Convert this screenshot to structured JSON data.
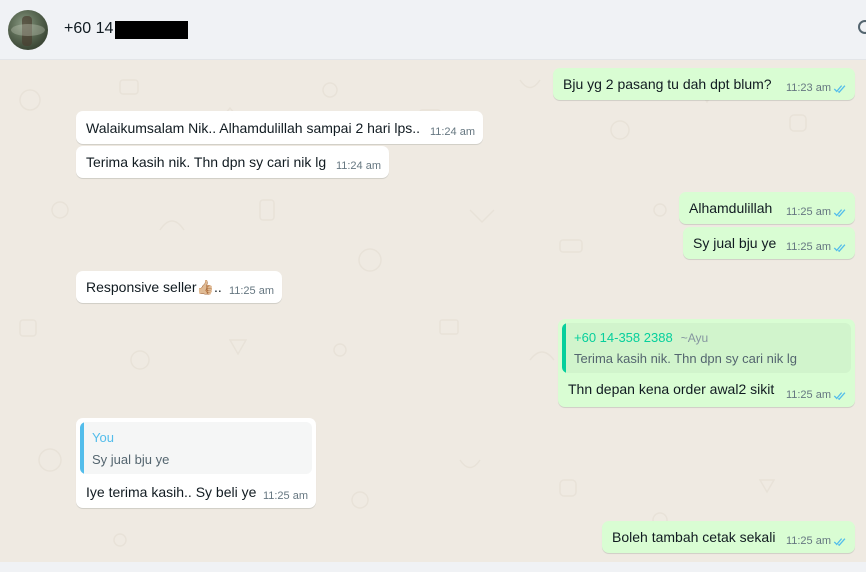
{
  "header": {
    "contact_name": "+60 14"
  },
  "messages": [
    {
      "text": "Bju yg 2 pasang tu dah dpt blum?",
      "time": "11:23 am"
    },
    {
      "text": "Walaikumsalam Nik.. Alhamdulillah sampai 2 hari lps..",
      "time": "11:24 am"
    },
    {
      "text": "Terima kasih nik. Thn dpn sy cari nik lg",
      "time": "11:24 am"
    },
    {
      "text": "Alhamdulillah",
      "time": "11:25 am"
    },
    {
      "text": "Sy jual bju ye",
      "time": "11:25 am"
    },
    {
      "text": "Responsive seller",
      "emoji": "👍🏼",
      "suffix": "..",
      "time": "11:25 am"
    },
    {
      "quote": {
        "author": "+60 14-358 2388",
        "pushname": "~Ayu",
        "text": "Terima kasih nik. Thn dpn sy cari nik lg"
      },
      "text": "Thn depan kena order awal2 sikit",
      "time": "11:25 am"
    },
    {
      "quote": {
        "author": "You",
        "text": "Sy jual bju ye"
      },
      "text": "Iye terima kasih.. Sy beli ye",
      "time": "11:25 am"
    },
    {
      "text": "Boleh tambah cetak sekali",
      "time": "11:25 am"
    }
  ],
  "colors": {
    "incoming": "#ffffff",
    "outgoing": "#d9fdd3",
    "wallpaper": "#efeae2",
    "read_tick": "#53bdeb",
    "quote_green": "#06cf9c",
    "quote_blue": "#53bdeb"
  }
}
